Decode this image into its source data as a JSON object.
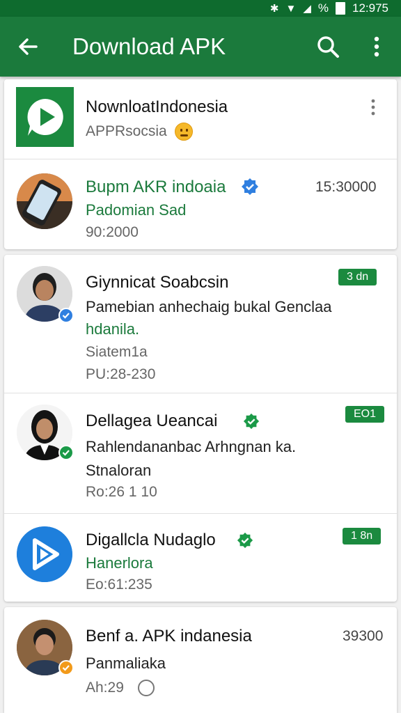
{
  "status_bar": {
    "time": "12:975",
    "percent": "%"
  },
  "app_bar": {
    "title": "Download APK"
  },
  "header_card": {
    "name": "NownloatIndonesia",
    "sub": "APPRsocsia"
  },
  "items": [
    {
      "name": "Bupm AKR indoaia",
      "line1": "Padomian Sad",
      "meta": "90:2000",
      "time": "15:30000"
    },
    {
      "name": "Giynnicat Soabcsin",
      "line1": "Pamebian anhechaig bukal Genclaa",
      "line2": "hdanila.",
      "line3": "Siatem1a",
      "meta": "PU:28-230",
      "chip": "3 dn"
    },
    {
      "name": "Dellagea Ueancai",
      "line1": "Rahlendananbac Arhngnan ka.",
      "line2": "Stnaloran",
      "meta": "Ro:26 1 10",
      "chip": "EO1"
    },
    {
      "name": "Digallcla Nudaglo",
      "line1": "Hanerlora",
      "meta": "Eo:61:235",
      "chip": "1 8n"
    },
    {
      "name": "Benf a. APK indanesia",
      "line1": "Panmaliaka",
      "meta": "Ah:29",
      "time": "39300"
    }
  ],
  "colors": {
    "primary": "#1b7a3c",
    "status": "#0e6b2e",
    "verified_blue": "#2f7fe0",
    "verified_green": "#1b9a48",
    "verified_orange": "#f29a1a"
  }
}
